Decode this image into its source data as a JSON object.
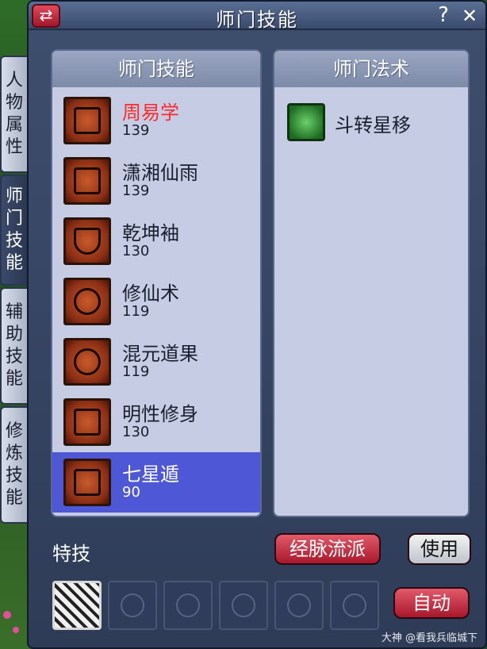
{
  "window": {
    "title": "师门技能",
    "swap_icon": "⇄",
    "help_icon": "?",
    "close_icon": "✕"
  },
  "tabs": [
    {
      "label": "人物属性",
      "chars": [
        "人",
        "物",
        "属",
        "性"
      ],
      "active": false
    },
    {
      "label": "师门技能",
      "chars": [
        "师",
        "门",
        "技",
        "能"
      ],
      "active": true
    },
    {
      "label": "辅助技能",
      "chars": [
        "辅",
        "助",
        "技",
        "能"
      ],
      "active": false
    },
    {
      "label": "修炼技能",
      "chars": [
        "修",
        "炼",
        "技",
        "能"
      ],
      "active": false
    }
  ],
  "skills_panel": {
    "header": "师门技能",
    "skills": [
      {
        "name": "周易学",
        "level": "139",
        "highlight": true,
        "icon": "yin-yang-icon"
      },
      {
        "name": "潇湘仙雨",
        "level": "139",
        "icon": "rune-icon"
      },
      {
        "name": "乾坤袖",
        "level": "130",
        "icon": "shield-yin-yang-icon"
      },
      {
        "name": "修仙术",
        "level": "119",
        "icon": "figure-icon"
      },
      {
        "name": "混元道果",
        "level": "119",
        "icon": "orbs-icon"
      },
      {
        "name": "明性修身",
        "level": "130",
        "icon": "dragon-icon"
      },
      {
        "name": "七星遁",
        "level": "90",
        "icon": "constellation-icon",
        "selected": true
      }
    ]
  },
  "spells_panel": {
    "header": "师门法术",
    "spells": [
      {
        "name": "斗转星移",
        "icon": "star-swap-icon"
      }
    ]
  },
  "bottom": {
    "special_label": "特技",
    "meridian_button": "经脉流派",
    "use_button": "使用",
    "auto_button": "自动"
  },
  "watermark": "大神 @看我兵临城下"
}
